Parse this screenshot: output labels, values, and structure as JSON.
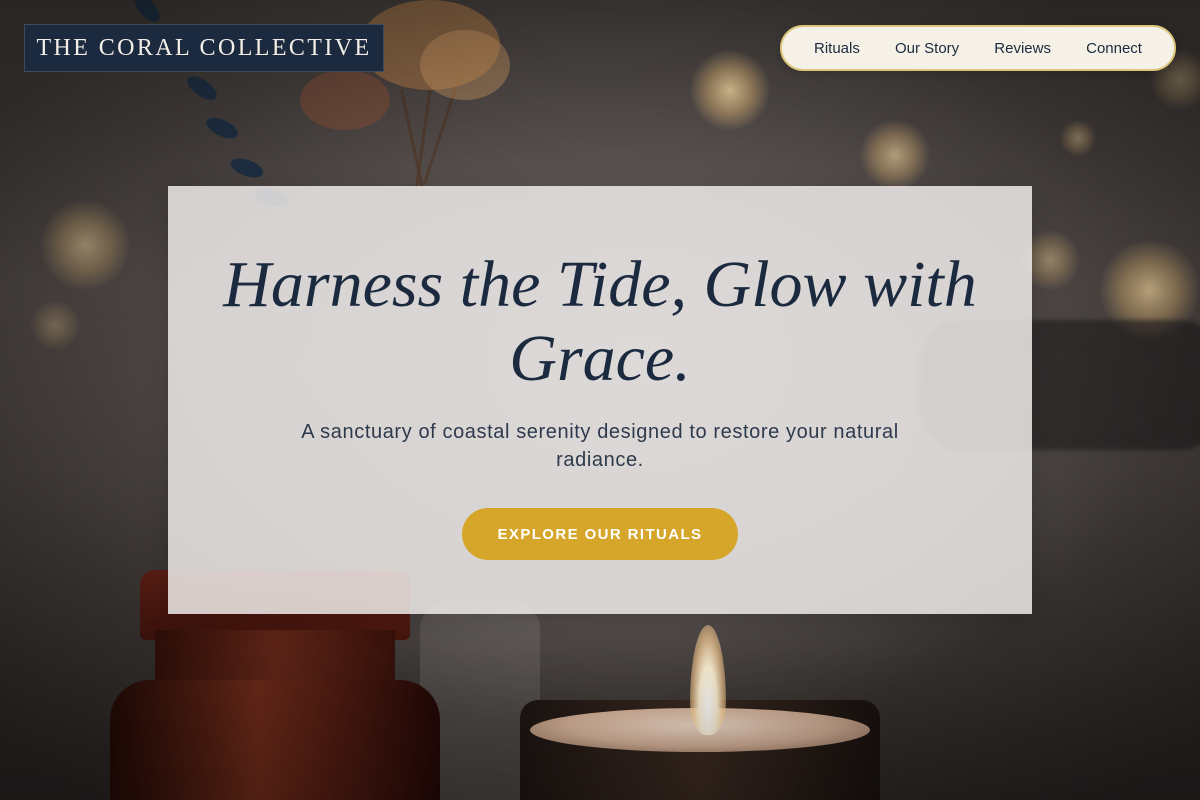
{
  "brand": {
    "name": "THE CORAL COLLECTIVE"
  },
  "nav": {
    "items": [
      {
        "label": "Rituals"
      },
      {
        "label": "Our Story"
      },
      {
        "label": "Reviews"
      },
      {
        "label": "Connect"
      }
    ]
  },
  "hero": {
    "title": "Harness the Tide, Glow with Grace.",
    "subtitle": "A sanctuary of coastal serenity designed to restore your natural radiance.",
    "cta_label": "EXPLORE OUR RITUALS"
  },
  "colors": {
    "brand_navy": "#1c2a40",
    "accent_gold": "#d6a62a",
    "nav_background": "#f6f1e6",
    "nav_border": "#dcc57a"
  }
}
